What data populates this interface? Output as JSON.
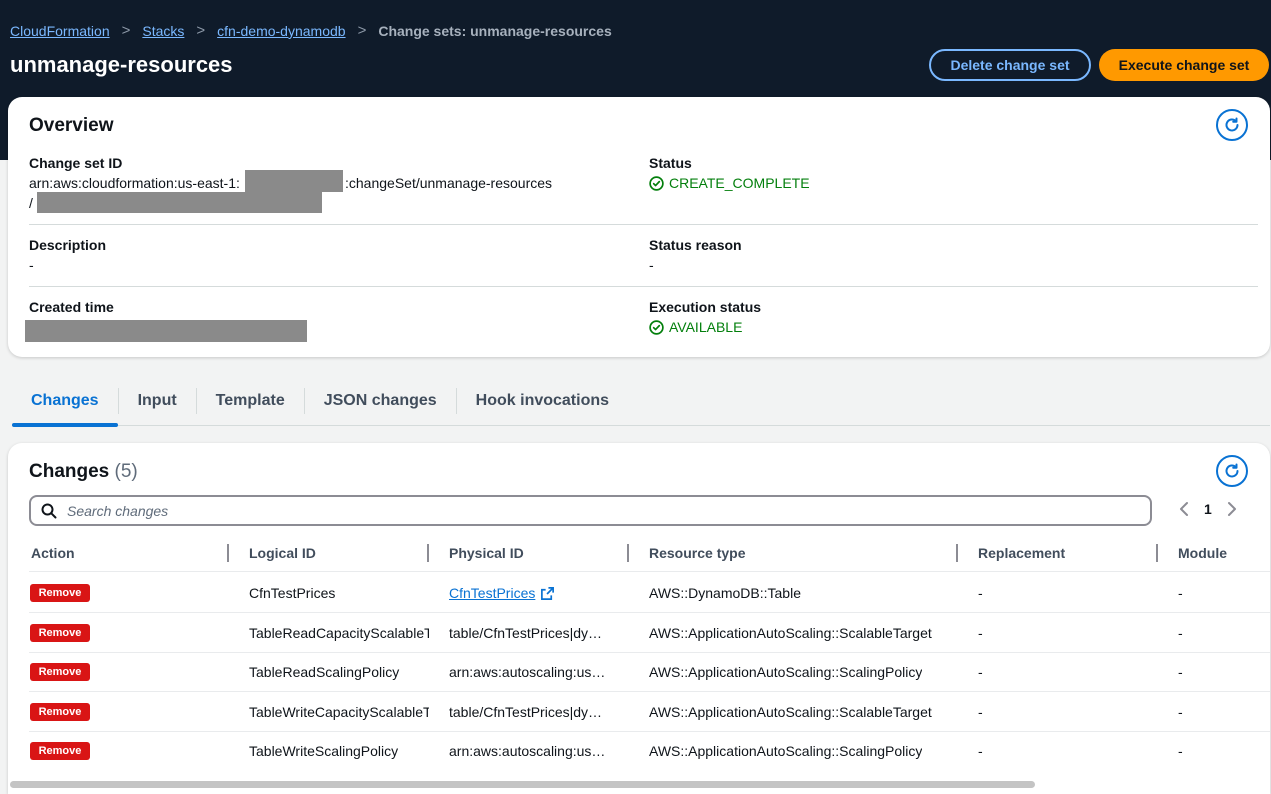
{
  "breadcrumb": {
    "items": [
      "CloudFormation",
      "Stacks",
      "cfn-demo-dynamodb"
    ],
    "current": "Change sets: unmanage-resources",
    "separator": ">"
  },
  "page": {
    "title": "unmanage-resources",
    "delete_label": "Delete change set",
    "execute_label": "Execute change set"
  },
  "overview": {
    "title": "Overview",
    "change_set_id_label": "Change set ID",
    "change_set_id_prefix": "arn:aws:cloudformation:us-east-1:",
    "change_set_id_suffix": ":changeSet/unmanage-resources",
    "change_set_id_line2": "/",
    "status_label": "Status",
    "status_value": "CREATE_COMPLETE",
    "description_label": "Description",
    "description_value": "-",
    "status_reason_label": "Status reason",
    "status_reason_value": "-",
    "created_time_label": "Created time",
    "execution_status_label": "Execution status",
    "execution_status_value": "AVAILABLE"
  },
  "tabs": [
    {
      "label": "Changes",
      "active": true
    },
    {
      "label": "Input",
      "active": false
    },
    {
      "label": "Template",
      "active": false
    },
    {
      "label": "JSON changes",
      "active": false
    },
    {
      "label": "Hook invocations",
      "active": false
    }
  ],
  "changes": {
    "title": "Changes",
    "count": "(5)",
    "search_placeholder": "Search changes",
    "page": "1",
    "columns": [
      "Action",
      "Logical ID",
      "Physical ID",
      "Resource type",
      "Replacement",
      "Module"
    ],
    "rows": [
      {
        "action": "Remove",
        "logical_id": "CfnTestPrices",
        "physical_id": "CfnTestPrices",
        "physical_link": true,
        "resource_type": "AWS::DynamoDB::Table",
        "replacement": "-",
        "module": "-"
      },
      {
        "action": "Remove",
        "logical_id": "TableReadCapacityScalableT",
        "physical_id": "table/CfnTestPrices|dy…",
        "physical_link": false,
        "resource_type": "AWS::ApplicationAutoScaling::ScalableTarget",
        "replacement": "-",
        "module": "-"
      },
      {
        "action": "Remove",
        "logical_id": "TableReadScalingPolicy",
        "physical_id": "arn:aws:autoscaling:us…",
        "physical_link": false,
        "resource_type": "AWS::ApplicationAutoScaling::ScalingPolicy",
        "replacement": "-",
        "module": "-"
      },
      {
        "action": "Remove",
        "logical_id": "TableWriteCapacityScalableT",
        "physical_id": "table/CfnTestPrices|dy…",
        "physical_link": false,
        "resource_type": "AWS::ApplicationAutoScaling::ScalableTarget",
        "replacement": "-",
        "module": "-"
      },
      {
        "action": "Remove",
        "logical_id": "TableWriteScalingPolicy",
        "physical_id": "arn:aws:autoscaling:us…",
        "physical_link": false,
        "resource_type": "AWS::ApplicationAutoScaling::ScalingPolicy",
        "replacement": "-",
        "module": "-"
      }
    ]
  },
  "colors": {
    "header_bg": "#0f1b2a",
    "link": "#7ab8ff",
    "accent": "#0972d3",
    "primary_button": "#ff9900",
    "success": "#037f0c",
    "remove_badge": "#d91515"
  }
}
